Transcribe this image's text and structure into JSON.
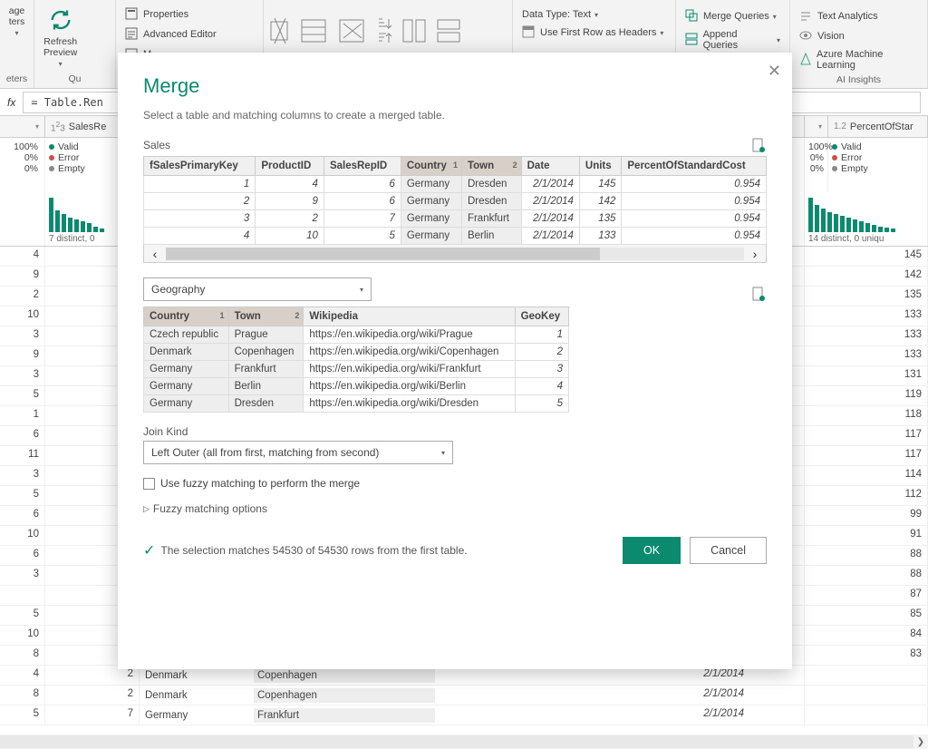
{
  "ribbon": {
    "group1_label": "eters",
    "refresh": "Refresh\nPreview",
    "properties": "Properties",
    "adv_editor": "Advanced Editor",
    "manage_prefix": "M",
    "group2_label": "Qu",
    "data_type": "Data Type: Text",
    "first_row": "Use First Row as Headers",
    "merge_q": "Merge Queries",
    "append_q": "Append Queries",
    "text_an": "Text Analytics",
    "vision": "Vision",
    "azure_ml": "Azure Machine Learning",
    "ai_label": "AI Insights",
    "params_btn": "age\nters"
  },
  "formula": "= Table.Ren",
  "grid": {
    "col_salesrep": "SalesRe",
    "col_percent": "PercentOfStar",
    "q_valid": "Valid",
    "q_error": "Error",
    "q_empty": "Empty",
    "pct100": "100%",
    "pct0": "0%",
    "distinct_left": "7 distinct, 0",
    "distinct_right": "14 distinct, 0 uniqu",
    "left_vals": [
      4,
      9,
      2,
      10,
      3,
      9,
      3,
      5,
      1,
      6,
      11,
      3,
      5,
      6,
      10,
      6,
      3,
      "",
      5,
      10,
      8,
      4,
      8,
      5
    ],
    "right_vals": [
      145,
      142,
      135,
      133,
      133,
      133,
      131,
      119,
      118,
      117,
      117,
      114,
      112,
      99,
      91,
      88,
      88,
      87,
      85,
      84,
      83
    ],
    "bg_countries": [
      "Denmark",
      "Denmark",
      "Germany"
    ],
    "bg_cities": [
      "Copenhagen",
      "Copenhagen",
      "Frankfurt"
    ],
    "bg_date": "2/1/2014",
    "bg_mid": [
      2,
      2,
      7
    ]
  },
  "modal": {
    "title": "Merge",
    "subtitle": "Select a table and matching columns to create a merged table.",
    "table1_name": "Sales",
    "t1_headers": [
      "fSalesPrimaryKey",
      "ProductID",
      "SalesRepID",
      "Country",
      "Town",
      "Date",
      "Units",
      "PercentOfStandardCost"
    ],
    "t1_sel_ord": {
      "Country": "1",
      "Town": "2"
    },
    "t1_rows": [
      [
        "1",
        "4",
        "6",
        "Germany",
        "Dresden",
        "2/1/2014",
        "145",
        "0.954"
      ],
      [
        "2",
        "9",
        "6",
        "Germany",
        "Dresden",
        "2/1/2014",
        "142",
        "0.954"
      ],
      [
        "3",
        "2",
        "7",
        "Germany",
        "Frankfurt",
        "2/1/2014",
        "135",
        "0.954"
      ],
      [
        "4",
        "10",
        "5",
        "Germany",
        "Berlin",
        "2/1/2014",
        "133",
        "0.954"
      ]
    ],
    "table2_select": "Geography",
    "t2_headers": [
      "Country",
      "Town",
      "Wikipedia",
      "GeoKey"
    ],
    "t2_sel_ord": {
      "Country": "1",
      "Town": "2"
    },
    "t2_rows": [
      [
        "Czech republic",
        "Prague",
        "https://en.wikipedia.org/wiki/Prague",
        "1"
      ],
      [
        "Denmark",
        "Copenhagen",
        "https://en.wikipedia.org/wiki/Copenhagen",
        "2"
      ],
      [
        "Germany",
        "Frankfurt",
        "https://en.wikipedia.org/wiki/Frankfurt",
        "3"
      ],
      [
        "Germany",
        "Berlin",
        "https://en.wikipedia.org/wiki/Berlin",
        "4"
      ],
      [
        "Germany",
        "Dresden",
        "https://en.wikipedia.org/wiki/Dresden",
        "5"
      ]
    ],
    "join_kind_label": "Join Kind",
    "join_kind": "Left Outer (all from first, matching from second)",
    "fuzzy_check": "Use fuzzy matching to perform the merge",
    "fuzzy_opts": "Fuzzy matching options",
    "match_msg": "The selection matches 54530 of 54530 rows from the first table.",
    "ok": "OK",
    "cancel": "Cancel"
  }
}
